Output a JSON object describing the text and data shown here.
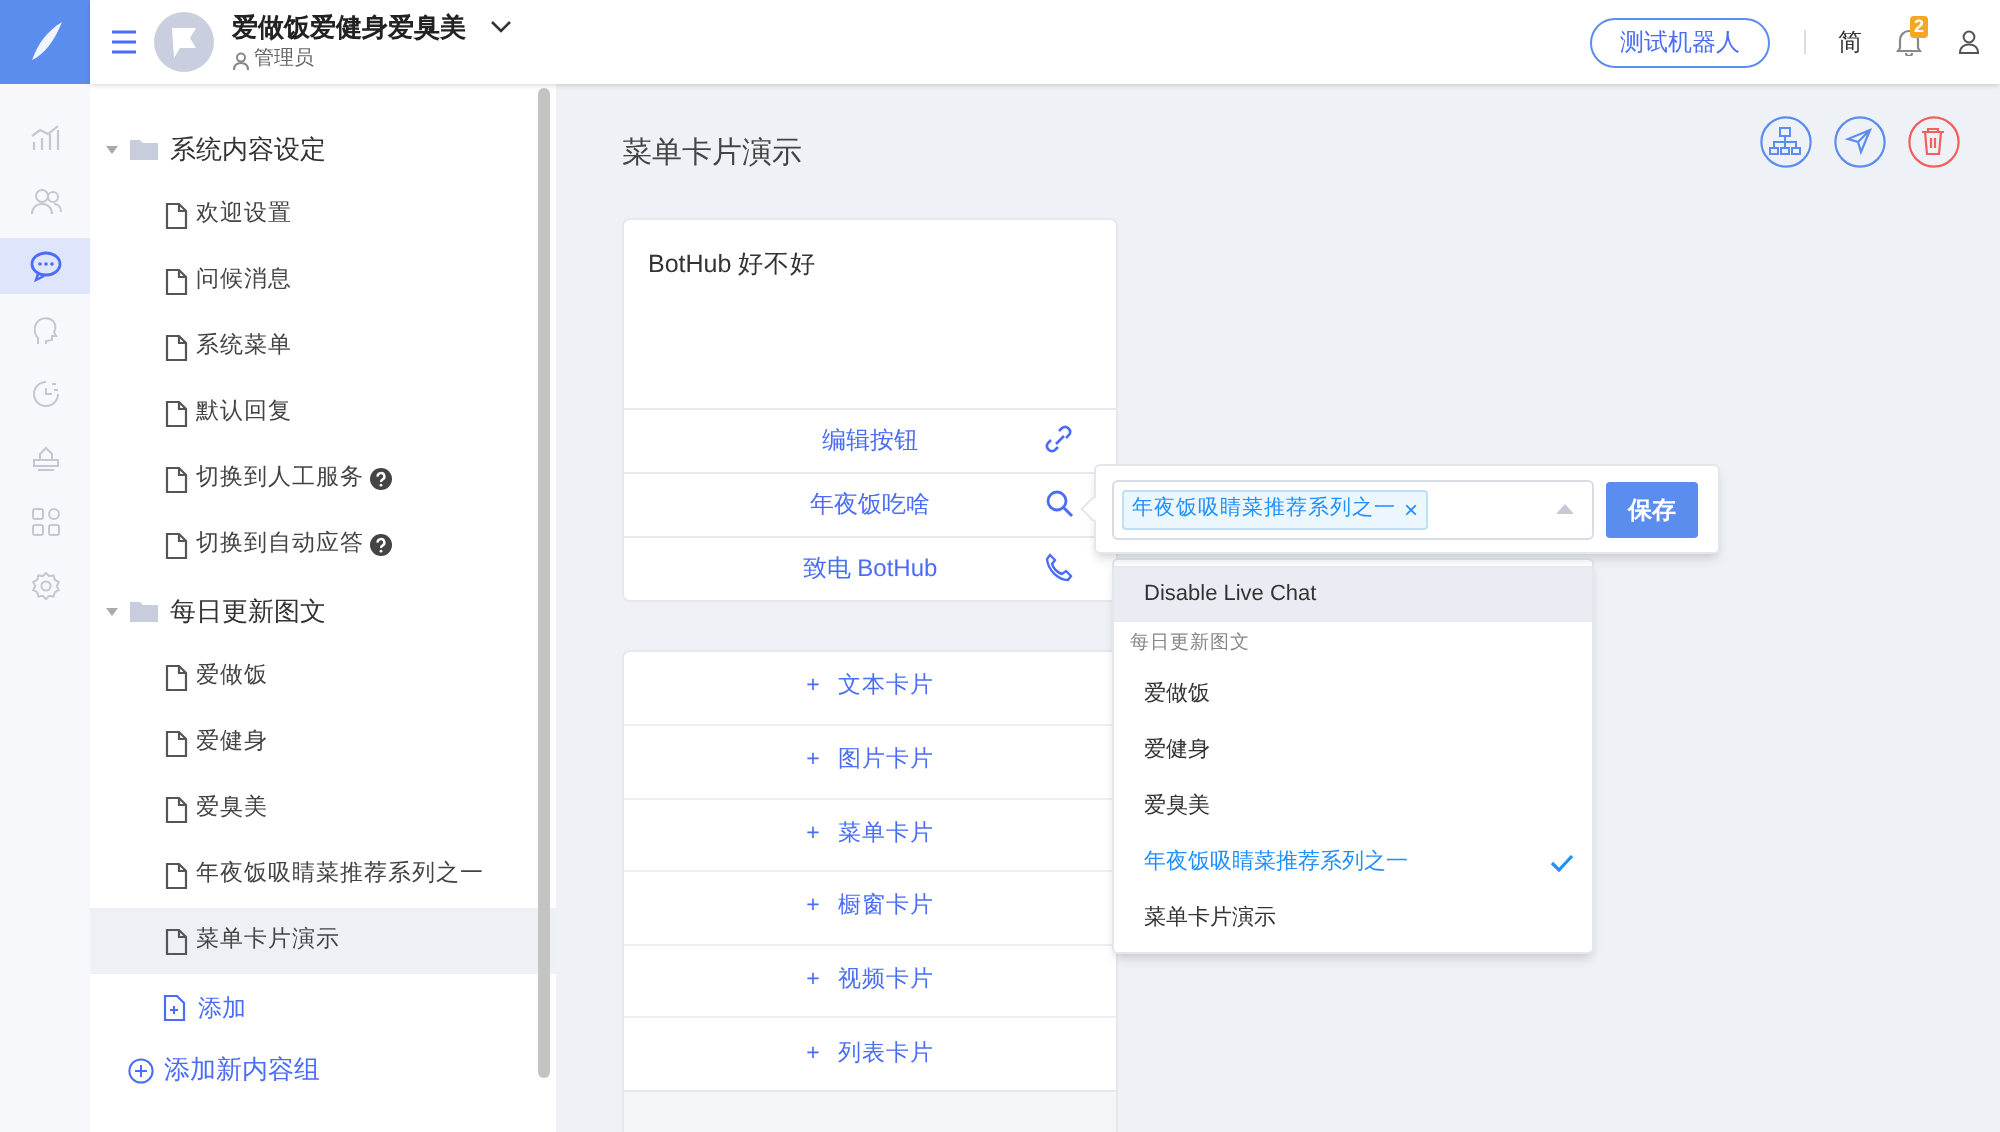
{
  "header": {
    "org_name": "爱做饭爱健身爱臭美",
    "role": "管理员",
    "test_button": "测试机器人",
    "language": "简",
    "notification_count": "2"
  },
  "rail": [
    {
      "kind": "chart",
      "selected": false
    },
    {
      "kind": "users",
      "selected": false
    },
    {
      "kind": "chat",
      "selected": true
    },
    {
      "kind": "head",
      "selected": false
    },
    {
      "kind": "clock",
      "selected": false
    },
    {
      "kind": "crown",
      "selected": false
    },
    {
      "kind": "apps",
      "selected": false
    },
    {
      "kind": "settings",
      "selected": false
    }
  ],
  "tree": [
    {
      "label": "系统内容设定",
      "expanded": true,
      "children": [
        {
          "label": "欢迎设置",
          "selected": false,
          "help": false
        },
        {
          "label": "问候消息",
          "selected": false,
          "help": false
        },
        {
          "label": "系统菜单",
          "selected": false,
          "help": false
        },
        {
          "label": "默认回复",
          "selected": false,
          "help": false
        },
        {
          "label": "切换到人工服务",
          "selected": false,
          "help": true
        },
        {
          "label": "切换到自动应答",
          "selected": false,
          "help": true
        }
      ]
    },
    {
      "label": "每日更新图文",
      "expanded": true,
      "add_label": "添加",
      "children": [
        {
          "label": "爱做饭",
          "selected": false,
          "help": false
        },
        {
          "label": "爱健身",
          "selected": false,
          "help": false
        },
        {
          "label": "爱臭美",
          "selected": false,
          "help": false
        },
        {
          "label": "年夜饭吸睛菜推荐系列之一",
          "selected": false,
          "help": false
        },
        {
          "label": "菜单卡片演示",
          "selected": true,
          "help": false
        }
      ]
    }
  ],
  "add_group": "添加新内容组",
  "page_title": "菜单卡片演示",
  "toolbar": [
    {
      "kind": "sitemap"
    },
    {
      "kind": "send"
    },
    {
      "kind": "delete"
    }
  ],
  "card": {
    "text": "BotHub 好不好",
    "buttons": [
      {
        "label": "编辑按钮",
        "kind": "link"
      },
      {
        "label": "年夜饭吃啥",
        "kind": "search"
      },
      {
        "label": "致电 BotHub",
        "kind": "phone"
      }
    ]
  },
  "add_cards": [
    "文本卡片",
    "图片卡片",
    "菜单卡片",
    "橱窗卡片",
    "视频卡片",
    "列表卡片"
  ],
  "add_plus": "+",
  "popover": {
    "tags": [
      "年夜饭吸睛菜推荐系列之一"
    ],
    "tag_remove": "×",
    "save": "保存",
    "options": [
      {
        "kind": "option",
        "label": "Disable Live Chat",
        "hovered": true,
        "selected": false
      },
      {
        "kind": "group",
        "label": "每日更新图文"
      },
      {
        "kind": "option",
        "label": "爱做饭",
        "hovered": false,
        "selected": false
      },
      {
        "kind": "option",
        "label": "爱健身",
        "hovered": false,
        "selected": false
      },
      {
        "kind": "option",
        "label": "爱臭美",
        "hovered": false,
        "selected": false
      },
      {
        "kind": "option",
        "label": "年夜饭吸睛菜推荐系列之一",
        "hovered": false,
        "selected": true
      },
      {
        "kind": "option",
        "label": "菜单卡片演示",
        "hovered": false,
        "selected": false
      }
    ]
  }
}
